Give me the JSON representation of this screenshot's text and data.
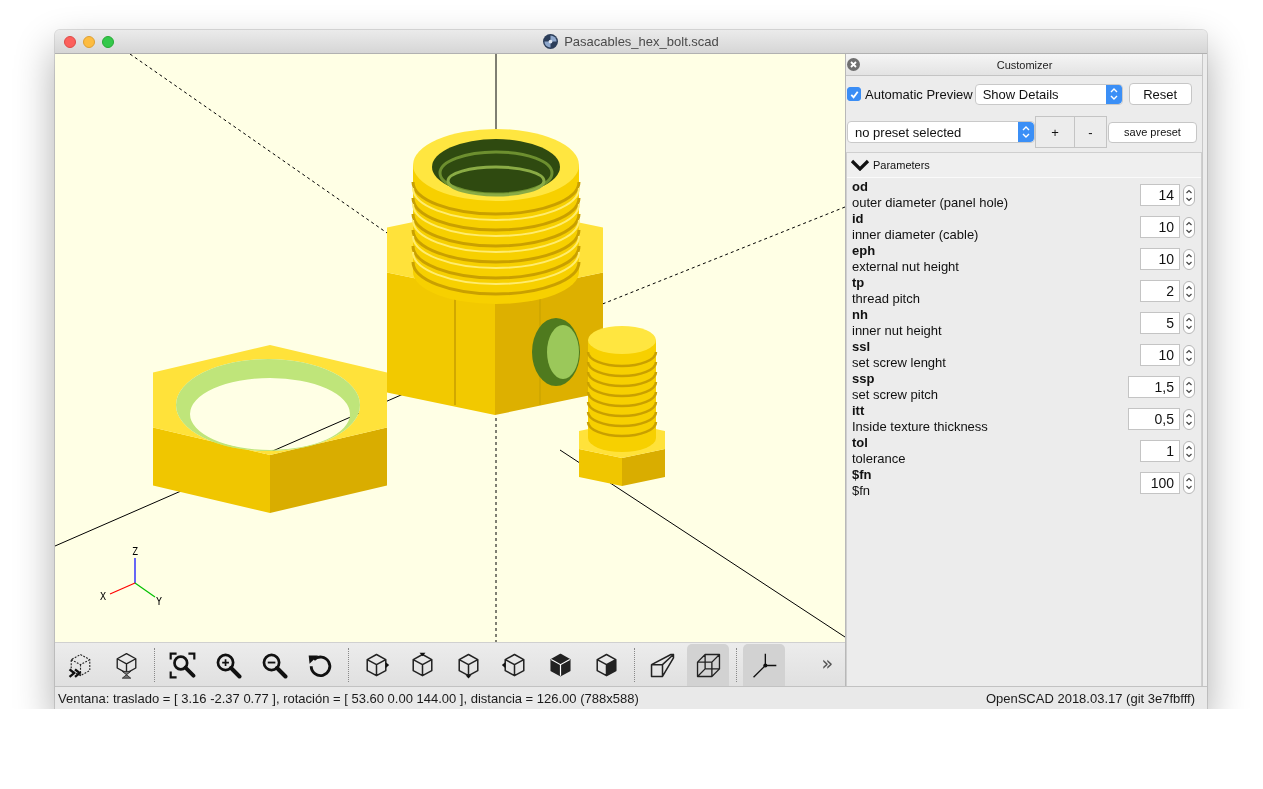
{
  "window": {
    "title": "Pasacables_hex_bolt.scad"
  },
  "viewport": {
    "axis_labels": {
      "z": "Z",
      "x": "X",
      "y": "Y"
    }
  },
  "toolbar": {
    "groups": [
      {
        "buttons": [
          {
            "kind": "preview",
            "selected": false
          },
          {
            "kind": "render",
            "selected": false
          }
        ]
      },
      {
        "buttons": [
          {
            "kind": "view_all",
            "selected": false
          },
          {
            "kind": "zoom_in",
            "selected": false
          },
          {
            "kind": "zoom_out",
            "selected": false
          },
          {
            "kind": "reset_view",
            "selected": false
          }
        ]
      },
      {
        "buttons": [
          {
            "kind": "view_right",
            "selected": false
          },
          {
            "kind": "view_top",
            "selected": false
          },
          {
            "kind": "view_bottom",
            "selected": false
          },
          {
            "kind": "view_left",
            "selected": false
          },
          {
            "kind": "view_front",
            "selected": false
          },
          {
            "kind": "view_back",
            "selected": false
          }
        ]
      },
      {
        "buttons": [
          {
            "kind": "perspective",
            "selected": false
          },
          {
            "kind": "orthogonal",
            "selected": true
          }
        ]
      },
      {
        "buttons": [
          {
            "kind": "show_axes",
            "selected": true
          }
        ]
      }
    ],
    "overflow": "»"
  },
  "customizer": {
    "title": "Customizer",
    "automatic_preview": {
      "label": "Automatic Preview",
      "checked": true
    },
    "detail_dropdown": {
      "value": "Show Details"
    },
    "reset_button": "Reset",
    "preset_dropdown": {
      "value": "no preset selected"
    },
    "add_preset_button": "+",
    "remove_preset_button": "-",
    "save_preset_button": "save preset",
    "group": {
      "title": "Parameters",
      "expanded": true,
      "parameters": [
        {
          "name": "od",
          "description": "outer diameter (panel hole)",
          "value": "14",
          "kind": "integer"
        },
        {
          "name": "id",
          "description": "inner diameter (cable)",
          "value": "10",
          "kind": "integer"
        },
        {
          "name": "eph",
          "description": "external nut height",
          "value": "10",
          "kind": "integer"
        },
        {
          "name": "tp",
          "description": "thread pitch",
          "value": "2",
          "kind": "integer"
        },
        {
          "name": "nh",
          "description": "inner nut height",
          "value": "5",
          "kind": "integer"
        },
        {
          "name": "ssl",
          "description": "set screw lenght",
          "value": "10",
          "kind": "integer"
        },
        {
          "name": "ssp",
          "description": "set screw pitch",
          "value": "1,5",
          "kind": "decimal"
        },
        {
          "name": "itt",
          "description": "Inside texture thickness",
          "value": "0,5",
          "kind": "decimal"
        },
        {
          "name": "tol",
          "description": "tolerance",
          "value": "1",
          "kind": "integer"
        },
        {
          "name": "$fn",
          "description": "$fn",
          "value": "100",
          "kind": "integer"
        }
      ]
    }
  },
  "status_bar": {
    "left": "Ventana: traslado = [ 3.16 -2.37 0.77 ], rotación = [ 53.60 0.00 144.00 ], distancia = 126.00 (788x588)",
    "right": "OpenSCAD 2018.03.17 (git 3e7fbfff)"
  }
}
